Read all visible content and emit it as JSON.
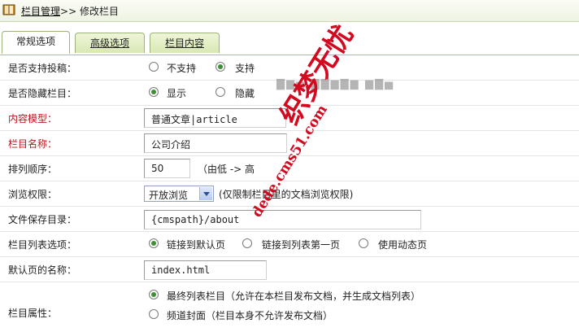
{
  "header": {
    "crumb_link": "栏目管理",
    "crumb_sep": ">>",
    "crumb_current": "修改栏目"
  },
  "tabs": [
    {
      "label": "常规选项",
      "active": true
    },
    {
      "label": "高级选项",
      "active": false
    },
    {
      "label": "栏目内容",
      "active": false
    }
  ],
  "form": {
    "contribute": {
      "label": "是否支持投稿：",
      "options": [
        "不支持",
        "支持"
      ],
      "selected": "支持"
    },
    "hidden": {
      "label": "是否隐藏栏目：",
      "options": [
        "显示",
        "隐藏"
      ],
      "selected": "显示"
    },
    "model": {
      "label": "内容模型：",
      "value": "普通文章|article"
    },
    "name": {
      "label": "栏目名称：",
      "value": "公司介绍"
    },
    "order": {
      "label": "排列顺序：",
      "value": "50",
      "hint": "（由低 -> 高"
    },
    "permission": {
      "label": "浏览权限：",
      "value": "开放浏览",
      "hint": "(仅限制栏目里的文档浏览权限)"
    },
    "save_dir": {
      "label": "文件保存目录：",
      "value": "{cmspath}/about"
    },
    "list_option": {
      "label": "栏目列表选项：",
      "options": [
        "链接到默认页",
        "链接到列表第一页",
        "使用动态页"
      ],
      "selected": "链接到默认页"
    },
    "default_page": {
      "label": "默认页的名称：",
      "value": "index.html"
    },
    "attribute": {
      "label": "栏目属性：",
      "options": [
        "最终列表栏目（允许在本栏目发布文档，并生成文档列表）",
        "频道封面（栏目本身不允许发布文档）"
      ],
      "selected": "最终列表栏目（允许在本栏目发布文档，并生成文档列表）"
    }
  },
  "watermark": {
    "chinese": "织梦无忧",
    "url": "dede.cms51.com",
    "color": "#d2091f"
  }
}
